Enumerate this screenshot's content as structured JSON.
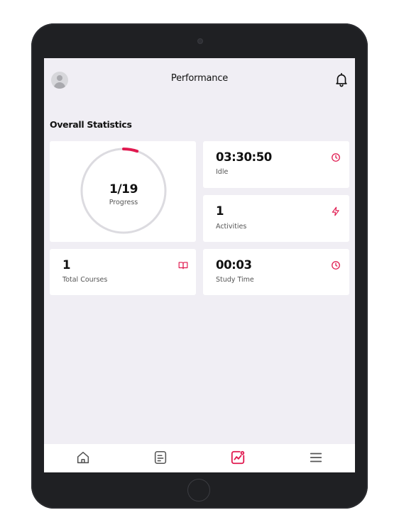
{
  "header": {
    "title": "Performance"
  },
  "section": {
    "title": "Overall Statistics"
  },
  "stats": {
    "progress": {
      "value": "1/19",
      "label": "Progress",
      "fraction": 0.0526
    },
    "idle": {
      "value": "03:30:50",
      "label": "Idle",
      "icon": "clock-icon"
    },
    "activities": {
      "value": "1",
      "label": "Activities",
      "icon": "lightning-icon"
    },
    "total_courses": {
      "value": "1",
      "label": "Total Courses",
      "icon": "book-icon"
    },
    "study_time": {
      "value": "00:03",
      "label": "Study Time",
      "icon": "clock-icon"
    }
  },
  "nav": {
    "items": [
      {
        "name": "home",
        "icon": "home-icon",
        "active": false
      },
      {
        "name": "courses",
        "icon": "document-icon",
        "active": false
      },
      {
        "name": "performance",
        "icon": "chart-icon",
        "active": true
      },
      {
        "name": "menu",
        "icon": "menu-icon",
        "active": false
      }
    ]
  },
  "colors": {
    "accent": "#e0194f",
    "background": "#f0eef4",
    "device": "#1f2023"
  }
}
